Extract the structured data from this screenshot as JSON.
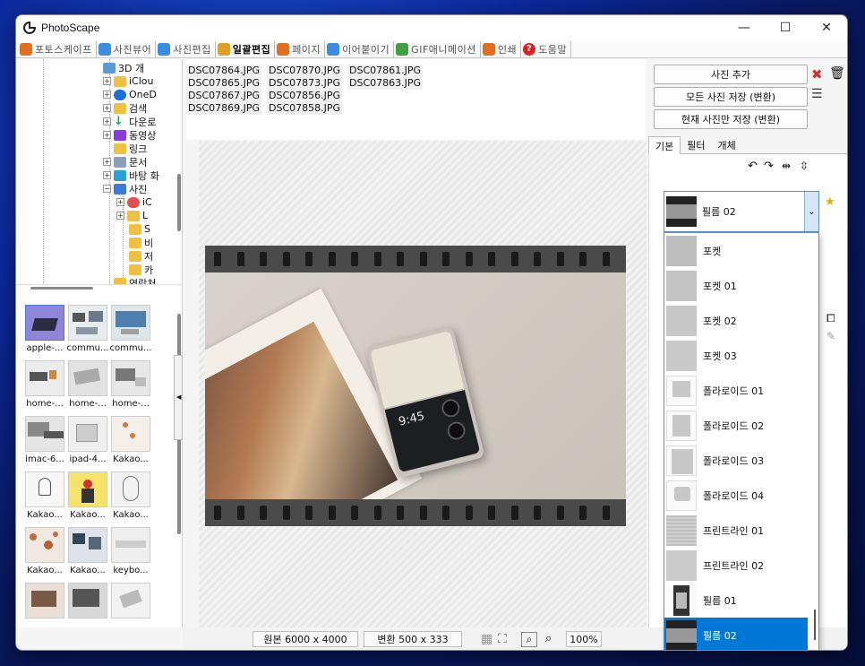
{
  "window": {
    "title": "PhotoScape",
    "minimize": "—",
    "maximize": "☐",
    "close": "✕"
  },
  "tabs": [
    {
      "label": "포토스케이프",
      "color": "#e07020"
    },
    {
      "label": "사진뷰어",
      "color": "#3a8ee0"
    },
    {
      "label": "사진편집",
      "color": "#3a8ee0"
    },
    {
      "label": "일괄편집",
      "color": "#e0a020"
    },
    {
      "label": "페이지",
      "color": "#e07020"
    },
    {
      "label": "이어붙이기",
      "color": "#3a8ee0"
    },
    {
      "label": "GIF애니메이션",
      "color": "#40a040"
    },
    {
      "label": "인쇄",
      "color": "#e07020"
    },
    {
      "label": "도움말",
      "color": "#e02020"
    }
  ],
  "tree": [
    {
      "label": "3D 개",
      "color": "#5a9ad8"
    },
    {
      "label": "iClou",
      "color": "#f0c040"
    },
    {
      "label": "OneD",
      "color": "#1e6fd8"
    },
    {
      "label": "검색",
      "color": "#f0c040"
    },
    {
      "label": "다운로",
      "color": "#2aa050"
    },
    {
      "label": "동영상",
      "color": "#8a3ae0"
    },
    {
      "label": "링크",
      "color": "#f0c040"
    },
    {
      "label": "문서",
      "color": "#8aa0b8"
    },
    {
      "label": "바탕 화",
      "color": "#2aa0d8"
    },
    {
      "label": "사진",
      "color": "#3a7ad8"
    },
    {
      "label": "iC",
      "color": "#e05050"
    },
    {
      "label": "L",
      "color": "#f0c040"
    },
    {
      "label": "S",
      "color": "#f0c040"
    },
    {
      "label": "비",
      "color": "#f0c040"
    },
    {
      "label": "저",
      "color": "#f0c040"
    },
    {
      "label": "카",
      "color": "#f0c040"
    },
    {
      "label": "연락처",
      "color": "#f0c040"
    }
  ],
  "thumbs": [
    [
      "apple-...",
      "commu...",
      "commu..."
    ],
    [
      "home-...",
      "home-...",
      "home-..."
    ],
    [
      "imac-6...",
      "ipad-4...",
      "Kakao..."
    ],
    [
      "Kakao...",
      "Kakao...",
      "Kakao..."
    ],
    [
      "Kakao...",
      "Kakao...",
      "keybo..."
    ],
    [
      "",
      "",
      ""
    ]
  ],
  "files": {
    "col1": [
      "DSC07864.JPG",
      "DSC07865.JPG",
      "DSC07867.JPG",
      "DSC07869.JPG"
    ],
    "col2": [
      "DSC07870.JPG",
      "DSC07873.JPG",
      "DSC07856.JPG",
      "DSC07858.JPG"
    ],
    "col3": [
      "DSC07861.JPG",
      "DSC07863.JPG"
    ]
  },
  "phone": {
    "time": "9:45"
  },
  "status": {
    "original": "원본 6000 x 4000",
    "converted": "변환 500 x 333",
    "zoom": "100%"
  },
  "right": {
    "add_photo": "사진 추가",
    "save_all": "모든 사진 저장 (변환)",
    "save_current": "현재 사진만 저장 (변환)",
    "tabs": [
      "기본",
      "필터",
      "개체"
    ],
    "selected_frame": "필름 02"
  },
  "frames": [
    "포켓",
    "포켓 01",
    "포켓 02",
    "포켓 03",
    "폴라로이드 01",
    "폴라로이드 02",
    "폴라로이드 03",
    "폴라로이드 04",
    "프린트라인 01",
    "프린트라인 02",
    "필름 01",
    "필름 02"
  ]
}
